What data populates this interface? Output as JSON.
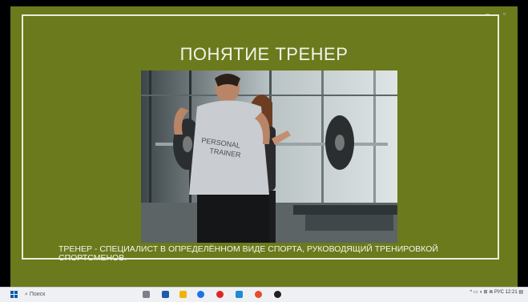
{
  "window": {
    "minimize_glyph": "–",
    "maximize_glyph": "▫"
  },
  "slide": {
    "title": "ПОНЯТИЕ ТРЕНЕР",
    "shirt_text_line1": "PERSONAL",
    "shirt_text_line2": "TRAINER",
    "caption": "ТРЕНЕР - СПЕЦИАЛИСТ В ОПРЕДЕЛЁННОМ ВИДЕ СПОРТА, РУКОВОДЯЩИЙ ТРЕНИРОВКОЙ СПОРТСМЕНОВ."
  },
  "taskbar": {
    "search_placeholder": "Поиск",
    "tray_lang": "РУС",
    "tray_time": "12:21",
    "colors": {
      "chrome": "#1a73e8",
      "opera": "#e02424",
      "edge": "#1e8ad6",
      "files": "#f0b400",
      "obs": "#202020"
    }
  }
}
